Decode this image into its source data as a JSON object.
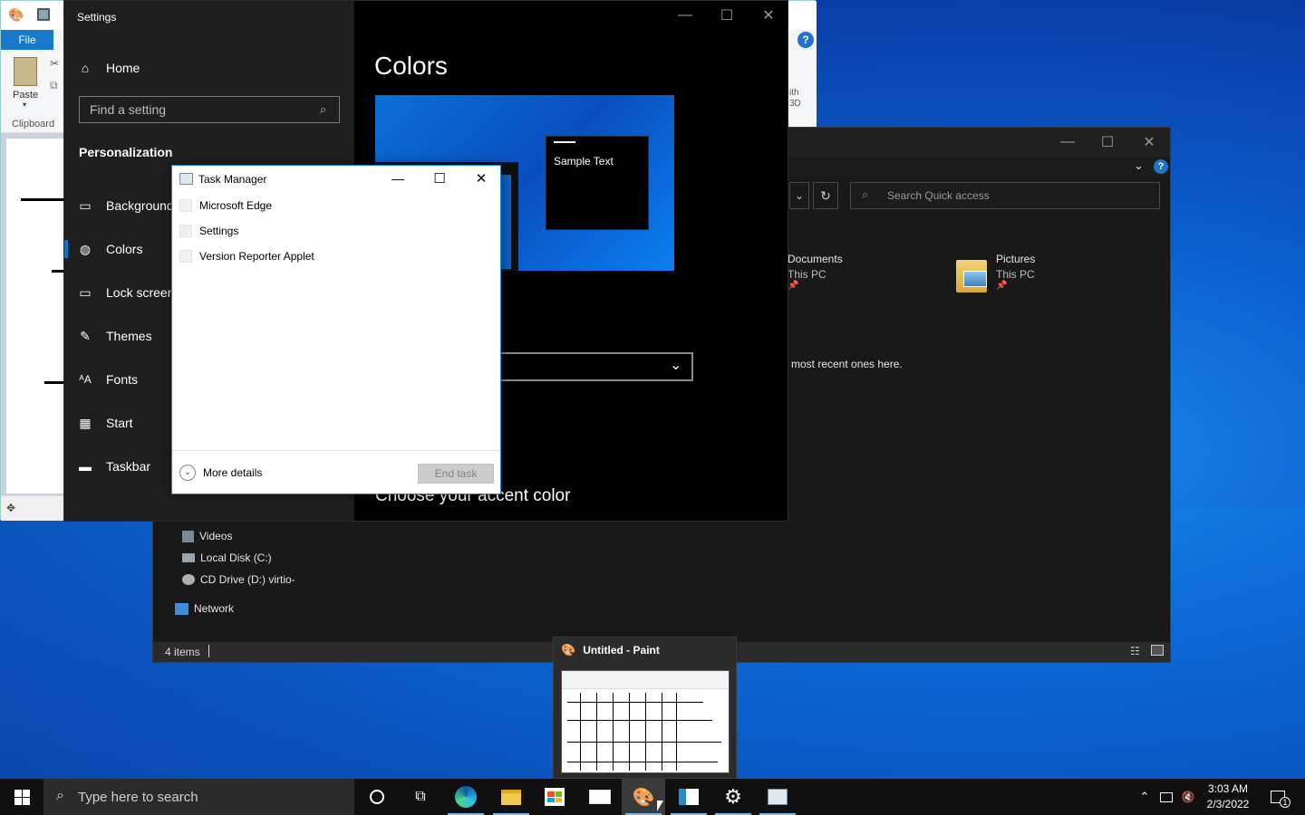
{
  "paint": {
    "file_tab": "File",
    "paste_label": "Paste",
    "clipboard_label": "Clipboard",
    "with_3d_line1": "ith",
    "with_3d_line2": "3D"
  },
  "settings": {
    "title": "Settings",
    "home": "Home",
    "search_placeholder": "Find a setting",
    "section": "Personalization",
    "nav": [
      {
        "label": "Background"
      },
      {
        "label": "Colors"
      },
      {
        "label": "Lock screen"
      },
      {
        "label": "Themes"
      },
      {
        "label": "Fonts"
      },
      {
        "label": "Start"
      },
      {
        "label": "Taskbar"
      }
    ],
    "page_title": "Colors",
    "sample_text": "Sample Text",
    "accent_heading": "Choose your accent color"
  },
  "explorer": {
    "search_placeholder": "Search Quick access",
    "items": [
      {
        "name": "Documents",
        "location": "This PC"
      },
      {
        "name": "Pictures",
        "location": "This PC"
      }
    ],
    "recent_hint": "most recent ones here.",
    "nav": [
      {
        "label": "Videos"
      },
      {
        "label": "Local Disk (C:)"
      },
      {
        "label": "CD Drive (D:) virtio-"
      },
      {
        "label": "Network"
      }
    ],
    "status": "4 items"
  },
  "taskmgr": {
    "title": "Task Manager",
    "apps": [
      {
        "label": "Microsoft Edge"
      },
      {
        "label": "Settings"
      },
      {
        "label": "Version Reporter Applet"
      }
    ],
    "more_details": "More details",
    "end_task": "End task"
  },
  "thumbnail": {
    "title": "Untitled - Paint"
  },
  "taskbar": {
    "search_placeholder": "Type here to search",
    "time": "3:03 AM",
    "date": "2/3/2022",
    "notification_count": "1"
  },
  "colors": {
    "accent": "#0078d7",
    "taskbar": "#101010",
    "settings_bg": "#000000"
  }
}
